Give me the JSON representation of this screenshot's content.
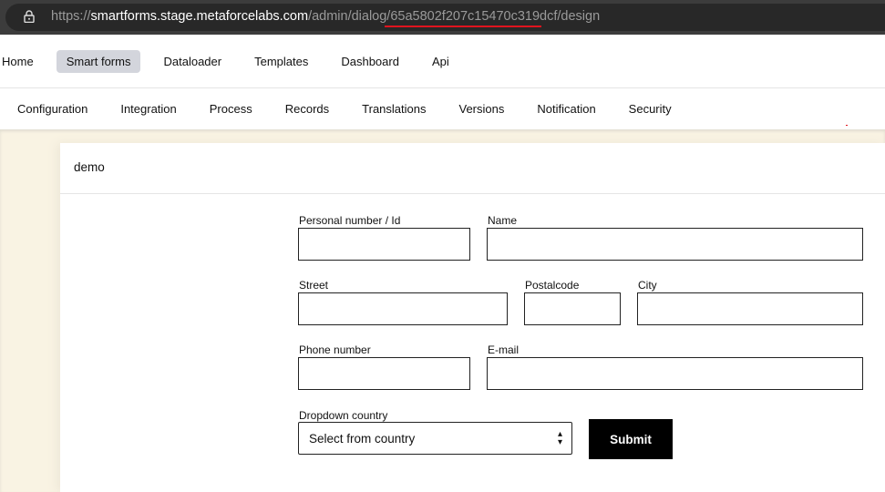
{
  "browser": {
    "url_scheme": "https://",
    "url_host": "smartforms.stage.metaforcelabs.com",
    "url_path_a": "/admin/dialog/",
    "url_id": "65a5802f207c15470c319dcf",
    "url_path_b": "/design"
  },
  "nav": {
    "items": [
      "Home",
      "Smart forms",
      "Dataloader",
      "Templates",
      "Dashboard",
      "Api"
    ],
    "active": "Smart forms"
  },
  "subnav": {
    "items": [
      "Configuration",
      "Integration",
      "Process",
      "Records",
      "Translations",
      "Versions",
      "Notification",
      "Security"
    ]
  },
  "form": {
    "title": "demo",
    "fields": {
      "personal_number": "Personal number / Id",
      "name": "Name",
      "street": "Street",
      "postalcode": "Postalcode",
      "city": "City",
      "phone": "Phone number",
      "email": "E-mail",
      "dropdown": "Dropdown country"
    },
    "dropdown_value": "Select from country",
    "submit_label": "Submit"
  },
  "colors": {
    "page_bg": "#f9f3e3",
    "active_nav": "#d3d5dc",
    "submit": "#000000",
    "highlight": "#e0141e"
  }
}
